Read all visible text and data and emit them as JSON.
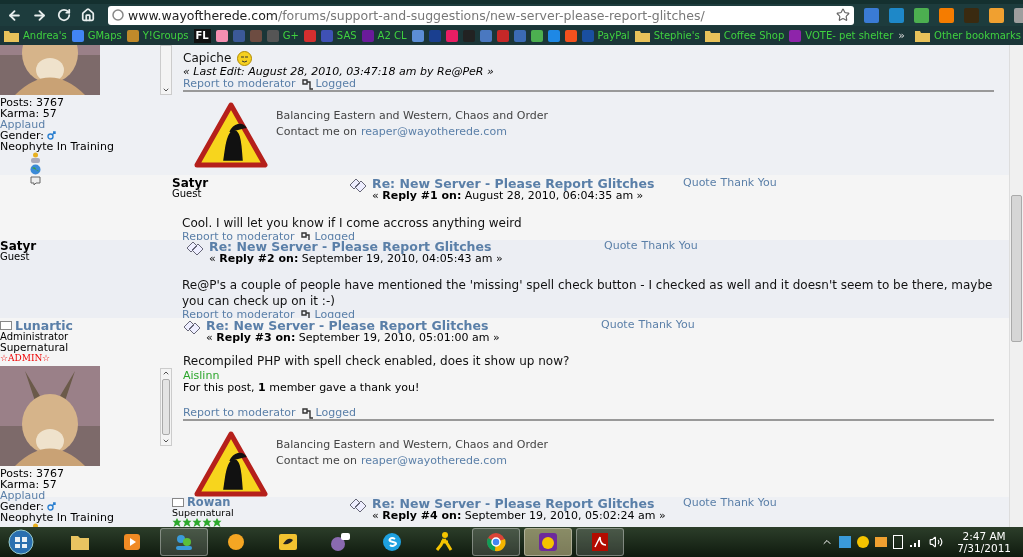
{
  "browser": {
    "url": {
      "domain": "www.wayoftherede.com",
      "path": "/forums/support-and-suggestions/new-server-please-report-glitches/"
    },
    "extensions": [
      {
        "color": "#3a7bd5"
      },
      {
        "color": "#1e88c8"
      },
      {
        "color": "#4caf50"
      },
      {
        "color": "#f57c00"
      },
      {
        "color": "#3a2a10"
      },
      {
        "color": "#f0a030"
      },
      {
        "color": "#9e9e9e"
      }
    ],
    "bookmarks": [
      {
        "kind": "folder",
        "label": "Andrea's"
      },
      {
        "kind": "site",
        "label": "GMaps",
        "color": "#4285f4"
      },
      {
        "kind": "site",
        "label": "Y!Groups",
        "color": "#c08a2a"
      },
      {
        "kind": "tile",
        "label": "FL",
        "color": "#111111"
      },
      {
        "kind": "site",
        "color": "#f48fb1"
      },
      {
        "kind": "site",
        "color": "#3b5998"
      },
      {
        "kind": "site",
        "color": "#6d4c41"
      },
      {
        "kind": "site",
        "label": "G+",
        "color": "#555555"
      },
      {
        "kind": "site",
        "color": "#d32f2f"
      },
      {
        "kind": "site",
        "label": "SAS",
        "color": "#3f51b5"
      },
      {
        "kind": "site",
        "label": "A2 CL",
        "color": "#6a1b9a"
      },
      {
        "kind": "site",
        "color": "#5c8ed6"
      },
      {
        "kind": "site",
        "color": "#1a3f8f"
      },
      {
        "kind": "site",
        "color": "#e91e63"
      },
      {
        "kind": "site",
        "color": "#222222"
      },
      {
        "kind": "site",
        "color": "#4a78c0"
      },
      {
        "kind": "site",
        "color": "#c62828"
      },
      {
        "kind": "site",
        "color": "#3b6bb5"
      },
      {
        "kind": "site",
        "color": "#4caf50"
      },
      {
        "kind": "site",
        "color": "#1e88e5"
      },
      {
        "kind": "site",
        "color": "#f4511e"
      },
      {
        "kind": "site",
        "label": "PayPal",
        "color": "#1a4fa0"
      },
      {
        "kind": "folder",
        "label": "Stephie's"
      },
      {
        "kind": "folder",
        "label": "Coffee Shop"
      },
      {
        "kind": "site",
        "label": "VOTE- pet shelter",
        "color": "#8e24aa"
      }
    ],
    "more": "»",
    "other": {
      "kind": "folder",
      "label": "Other bookmarks"
    }
  },
  "posts": [
    {
      "kind": "tail",
      "author": {
        "avatar": true,
        "stats": [
          {
            "kind": "text",
            "label": "Posts: 3767"
          },
          {
            "kind": "text",
            "label": "Karma: 57"
          },
          {
            "kind": "link",
            "label": "Applaud"
          },
          {
            "kind": "gender",
            "label": "Gender:"
          },
          {
            "kind": "text",
            "label": "Neophyte In Training"
          }
        ]
      },
      "body": "Capiche",
      "smiley": true,
      "last_edit": "« Last Edit: August 28, 2010, 03:47:18 am by Re@PeR »",
      "report": "Report to moderator",
      "logged": "Logged",
      "signature": {
        "motto": "Balancing Eastern and Western, Chaos and Order",
        "contact": "Contact me on",
        "email": "reaper@wayotherede.com"
      }
    },
    {
      "kind": "offset",
      "author": {
        "kind": "guest",
        "name": "Satyr",
        "title": "Guest"
      },
      "heading": {
        "title": "Re: New Server - Please Report Glitches",
        "reply_line": "« **Reply #1 on:** August 28, 2010, 06:04:35 am »"
      },
      "actions": [
        "Quote",
        "Thank You"
      ],
      "body": "Cool. I will let you know if I come accross anything weird",
      "report": "Report to moderator",
      "logged": "Logged"
    },
    {
      "kind": "flush",
      "author": {
        "kind": "guest",
        "name": "Satyr",
        "title": "Guest"
      },
      "heading": {
        "title": "Re: New Server - Please Report Glitches",
        "reply_line": "« **Reply #2 on:** September 19, 2010, 04:05:43 am »"
      },
      "actions": [
        "Quote",
        "Thank You"
      ],
      "body": "Re@P's a couple of people have mentioned the 'missing' spell check button - I checked as well and it doesn't seem to be there, maybe you can check up on it :-)",
      "report": "Report to moderator",
      "logged": "Logged"
    },
    {
      "kind": "full",
      "author": {
        "kind": "member",
        "name": "Lunartic",
        "title": "Administrator",
        "group": "Supernatural",
        "badge": "☆ADMIN☆",
        "avatar": true,
        "stats": [
          {
            "kind": "text",
            "label": "Posts: 3767"
          },
          {
            "kind": "text",
            "label": "Karma: 57"
          },
          {
            "kind": "link",
            "label": "Applaud"
          },
          {
            "kind": "gender",
            "label": "Gender:"
          },
          {
            "kind": "text",
            "label": "Neophyte In Training"
          }
        ]
      },
      "heading": {
        "title": "Re: New Server - Please Report Glitches",
        "reply_line": "« **Reply #3 on:** September 19, 2010, 05:01:00 am »"
      },
      "actions": [
        "Quote",
        "Thank You"
      ],
      "body": "Recompiled PHP with spell check enabled, does it show up now?",
      "thanks": {
        "member": "Aislinn",
        "text": "For this post, **1** member gave a thank you!"
      },
      "report": "Report to moderator",
      "logged": "Logged",
      "signature": {
        "motto": "Balancing Eastern and Western, Chaos and Order",
        "contact": "Contact me on",
        "email": "reaper@wayotherede.com"
      }
    },
    {
      "kind": "offset",
      "author": {
        "kind": "member",
        "name": "Rowan",
        "group": "Supernatural",
        "stars": 5
      },
      "heading": {
        "title": "Re: New Server - Please Report Glitches",
        "reply_line": "« **Reply #4 on:** September 19, 2010, 05:02:24 am »"
      },
      "actions": [
        "Quote",
        "Thank You"
      ]
    }
  ],
  "taskbar": {
    "items": [
      {
        "kind": "folder",
        "open": false,
        "selected": false
      },
      {
        "kind": "media",
        "open": false,
        "selected": false
      },
      {
        "kind": "messenger",
        "open": true,
        "selected": false
      },
      {
        "kind": "sun",
        "open": false,
        "selected": false
      },
      {
        "kind": "bird",
        "open": false,
        "selected": false
      },
      {
        "kind": "pidgin",
        "open": false,
        "selected": false
      },
      {
        "kind": "skype",
        "open": false,
        "selected": false
      },
      {
        "kind": "runner",
        "open": false,
        "selected": false
      },
      {
        "kind": "chrome",
        "open": true,
        "selected": false
      },
      {
        "kind": "yahoo",
        "open": true,
        "selected": true
      },
      {
        "kind": "pdf",
        "open": true,
        "selected": false
      }
    ],
    "time": "2:47 AM",
    "date": "7/31/2011"
  }
}
